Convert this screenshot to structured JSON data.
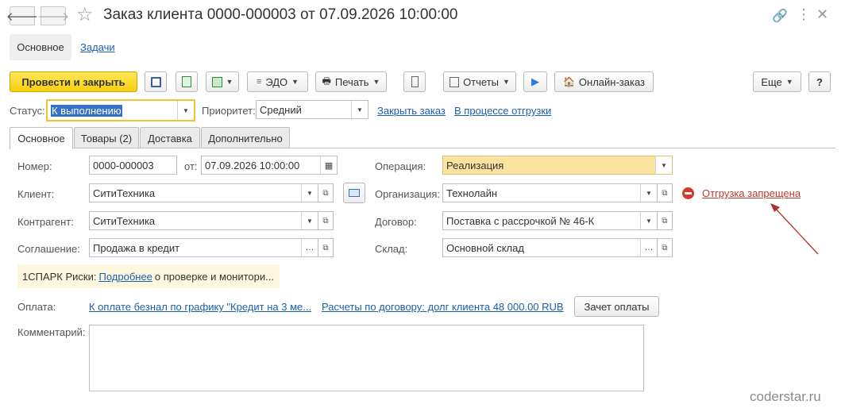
{
  "header": {
    "title": "Заказ клиента 0000-000003 от 07.09.2026 10:00:00",
    "back_icon": "arrow-left-icon",
    "forward_icon": "arrow-right-icon"
  },
  "sections": {
    "main": "Основное",
    "tasks": "Задачи"
  },
  "toolbar": {
    "post_close": "Провести и закрыть",
    "edo": "ЭДО",
    "print": "Печать",
    "reports": "Отчеты",
    "online_order": "Онлайн-заказ",
    "more": "Еще",
    "help": "?"
  },
  "status_row": {
    "status_label": "Статус:",
    "status_value": "К выполнению",
    "priority_label": "Приоритет:",
    "priority_value": "Средний",
    "close_link": "Закрыть заказ",
    "shipping_link": "В процессе отгрузки"
  },
  "tabs": [
    "Основное",
    "Товары (2)",
    "Доставка",
    "Дополнительно"
  ],
  "form": {
    "number_label": "Номер:",
    "number_value": "0000-000003",
    "date_label": "от:",
    "date_value": "07.09.2026 10:00:00",
    "client_label": "Клиент:",
    "client_value": "СитиТехника",
    "counterparty_label": "Контрагент:",
    "counterparty_value": "СитиТехника",
    "agreement_label": "Соглашение:",
    "agreement_value": "Продажа в кредит",
    "operation_label": "Операция:",
    "operation_value": "Реализация",
    "organization_label": "Организация:",
    "organization_value": "Технолайн",
    "contract_label": "Договор:",
    "contract_value": "Поставка с рассрочкой № 46-К",
    "warehouse_label": "Склад:",
    "warehouse_value": "Основной склад",
    "shipment_forbidden": "Отгрузка запрещена"
  },
  "spark": {
    "prefix": "1СПАРК Риски: ",
    "link": "Подробнее",
    "suffix": " о проверке и монитори..."
  },
  "payment": {
    "label": "Оплата:",
    "schedule_link": "К оплате безнал по графику \"Кредит на 3 ме...",
    "settlement_link": "Расчеты по договору: долг клиента 48 000.00 RUB",
    "offset_button": "Зачет оплаты"
  },
  "comment_label": "Комментарий:",
  "watermark": "coderstar.ru",
  "colors": {
    "accent_yellow": "#f5cf10",
    "link_blue": "#1a5fae",
    "error_red": "#c0392b",
    "highlight": "#fde3a0"
  }
}
